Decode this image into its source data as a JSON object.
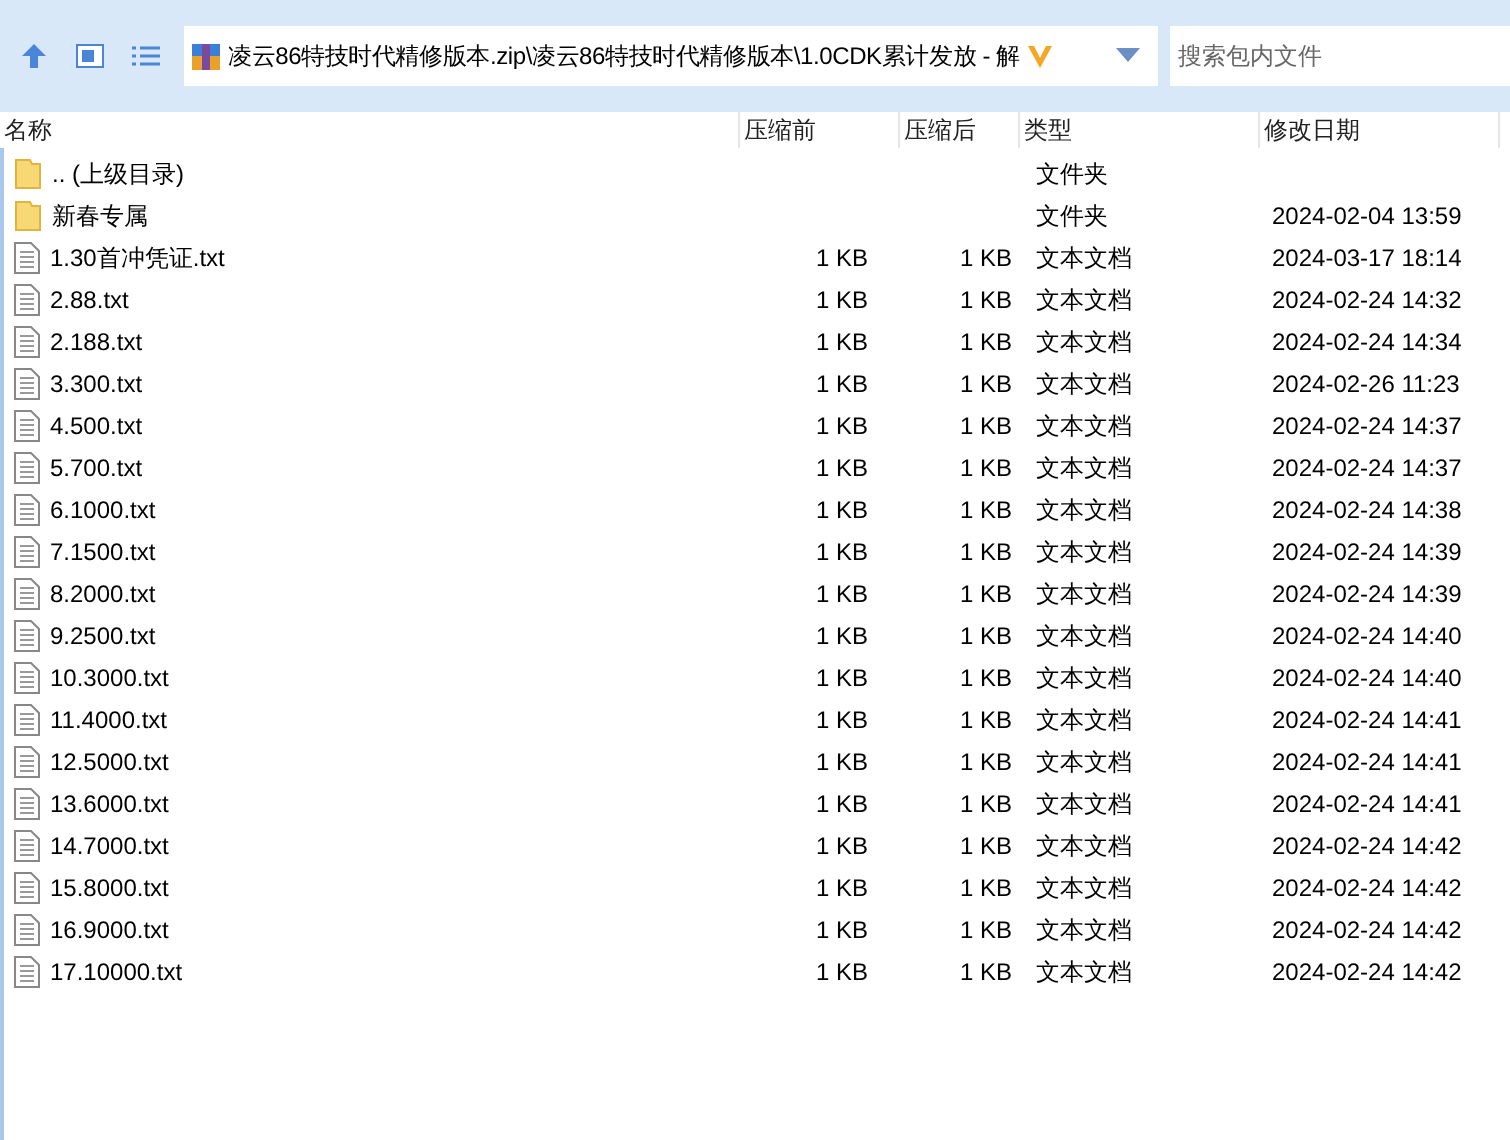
{
  "address": {
    "path": "凌云86特技时代精修版本.zip\\凌云86特技时代精修版本\\1.0CDK累计发放 - 解"
  },
  "search": {
    "placeholder": "搜索包内文件"
  },
  "columns": [
    "名称",
    "压缩前",
    "压缩后",
    "类型",
    "修改日期"
  ],
  "rows": [
    {
      "kind": "folder",
      "name": ".. (上级目录)",
      "size": "",
      "packed": "",
      "type": "文件夹",
      "modified": ""
    },
    {
      "kind": "folder",
      "name": "新春专属",
      "size": "",
      "packed": "",
      "type": "文件夹",
      "modified": "2024-02-04 13:59"
    },
    {
      "kind": "file",
      "name": "1.30首冲凭证.txt",
      "size": "1 KB",
      "packed": "1 KB",
      "type": "文本文档",
      "modified": "2024-03-17 18:14"
    },
    {
      "kind": "file",
      "name": "2.88.txt",
      "size": "1 KB",
      "packed": "1 KB",
      "type": "文本文档",
      "modified": "2024-02-24 14:32"
    },
    {
      "kind": "file",
      "name": "2.188.txt",
      "size": "1 KB",
      "packed": "1 KB",
      "type": "文本文档",
      "modified": "2024-02-24 14:34"
    },
    {
      "kind": "file",
      "name": "3.300.txt",
      "size": "1 KB",
      "packed": "1 KB",
      "type": "文本文档",
      "modified": "2024-02-26 11:23"
    },
    {
      "kind": "file",
      "name": "4.500.txt",
      "size": "1 KB",
      "packed": "1 KB",
      "type": "文本文档",
      "modified": "2024-02-24 14:37"
    },
    {
      "kind": "file",
      "name": "5.700.txt",
      "size": "1 KB",
      "packed": "1 KB",
      "type": "文本文档",
      "modified": "2024-02-24 14:37"
    },
    {
      "kind": "file",
      "name": "6.1000.txt",
      "size": "1 KB",
      "packed": "1 KB",
      "type": "文本文档",
      "modified": "2024-02-24 14:38"
    },
    {
      "kind": "file",
      "name": "7.1500.txt",
      "size": "1 KB",
      "packed": "1 KB",
      "type": "文本文档",
      "modified": "2024-02-24 14:39"
    },
    {
      "kind": "file",
      "name": "8.2000.txt",
      "size": "1 KB",
      "packed": "1 KB",
      "type": "文本文档",
      "modified": "2024-02-24 14:39"
    },
    {
      "kind": "file",
      "name": "9.2500.txt",
      "size": "1 KB",
      "packed": "1 KB",
      "type": "文本文档",
      "modified": "2024-02-24 14:40"
    },
    {
      "kind": "file",
      "name": "10.3000.txt",
      "size": "1 KB",
      "packed": "1 KB",
      "type": "文本文档",
      "modified": "2024-02-24 14:40"
    },
    {
      "kind": "file",
      "name": "11.4000.txt",
      "size": "1 KB",
      "packed": "1 KB",
      "type": "文本文档",
      "modified": "2024-02-24 14:41"
    },
    {
      "kind": "file",
      "name": "12.5000.txt",
      "size": "1 KB",
      "packed": "1 KB",
      "type": "文本文档",
      "modified": "2024-02-24 14:41"
    },
    {
      "kind": "file",
      "name": "13.6000.txt",
      "size": "1 KB",
      "packed": "1 KB",
      "type": "文本文档",
      "modified": "2024-02-24 14:41"
    },
    {
      "kind": "file",
      "name": "14.7000.txt",
      "size": "1 KB",
      "packed": "1 KB",
      "type": "文本文档",
      "modified": "2024-02-24 14:42"
    },
    {
      "kind": "file",
      "name": "15.8000.txt",
      "size": "1 KB",
      "packed": "1 KB",
      "type": "文本文档",
      "modified": "2024-02-24 14:42"
    },
    {
      "kind": "file",
      "name": "16.9000.txt",
      "size": "1 KB",
      "packed": "1 KB",
      "type": "文本文档",
      "modified": "2024-02-24 14:42"
    },
    {
      "kind": "file",
      "name": "17.10000.txt",
      "size": "1 KB",
      "packed": "1 KB",
      "type": "文本文档",
      "modified": "2024-02-24 14:42"
    }
  ]
}
